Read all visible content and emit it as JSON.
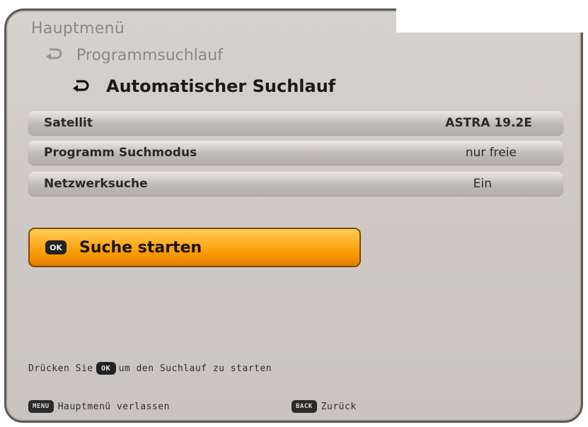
{
  "screen": {
    "title": "Hauptmenü",
    "breadcrumb": [
      "Programmsuchlauf",
      "Automatischer Suchlauf"
    ]
  },
  "settings": [
    {
      "label": "Satellit",
      "value": "ASTRA 19.2E"
    },
    {
      "label": "Programm Suchmodus",
      "value": "nur freie"
    },
    {
      "label": "Netzwerksuche",
      "value": "Ein"
    }
  ],
  "start_button": {
    "key": "OK",
    "label": "Suche starten"
  },
  "hint": {
    "before": "Drücken Sie",
    "key": "OK",
    "after": "um den Suchlauf zu starten"
  },
  "footer": {
    "menu_key": "MENU",
    "menu_label": "Hauptmenü verlassen",
    "back_key": "BACK",
    "back_label": "Zurück"
  },
  "colors": {
    "panel": "#cfcac6",
    "highlight": "#f79700",
    "border": "#5d5854"
  },
  "icons": {
    "breadcrumb_arrow": "curved-return-arrow-icon"
  }
}
